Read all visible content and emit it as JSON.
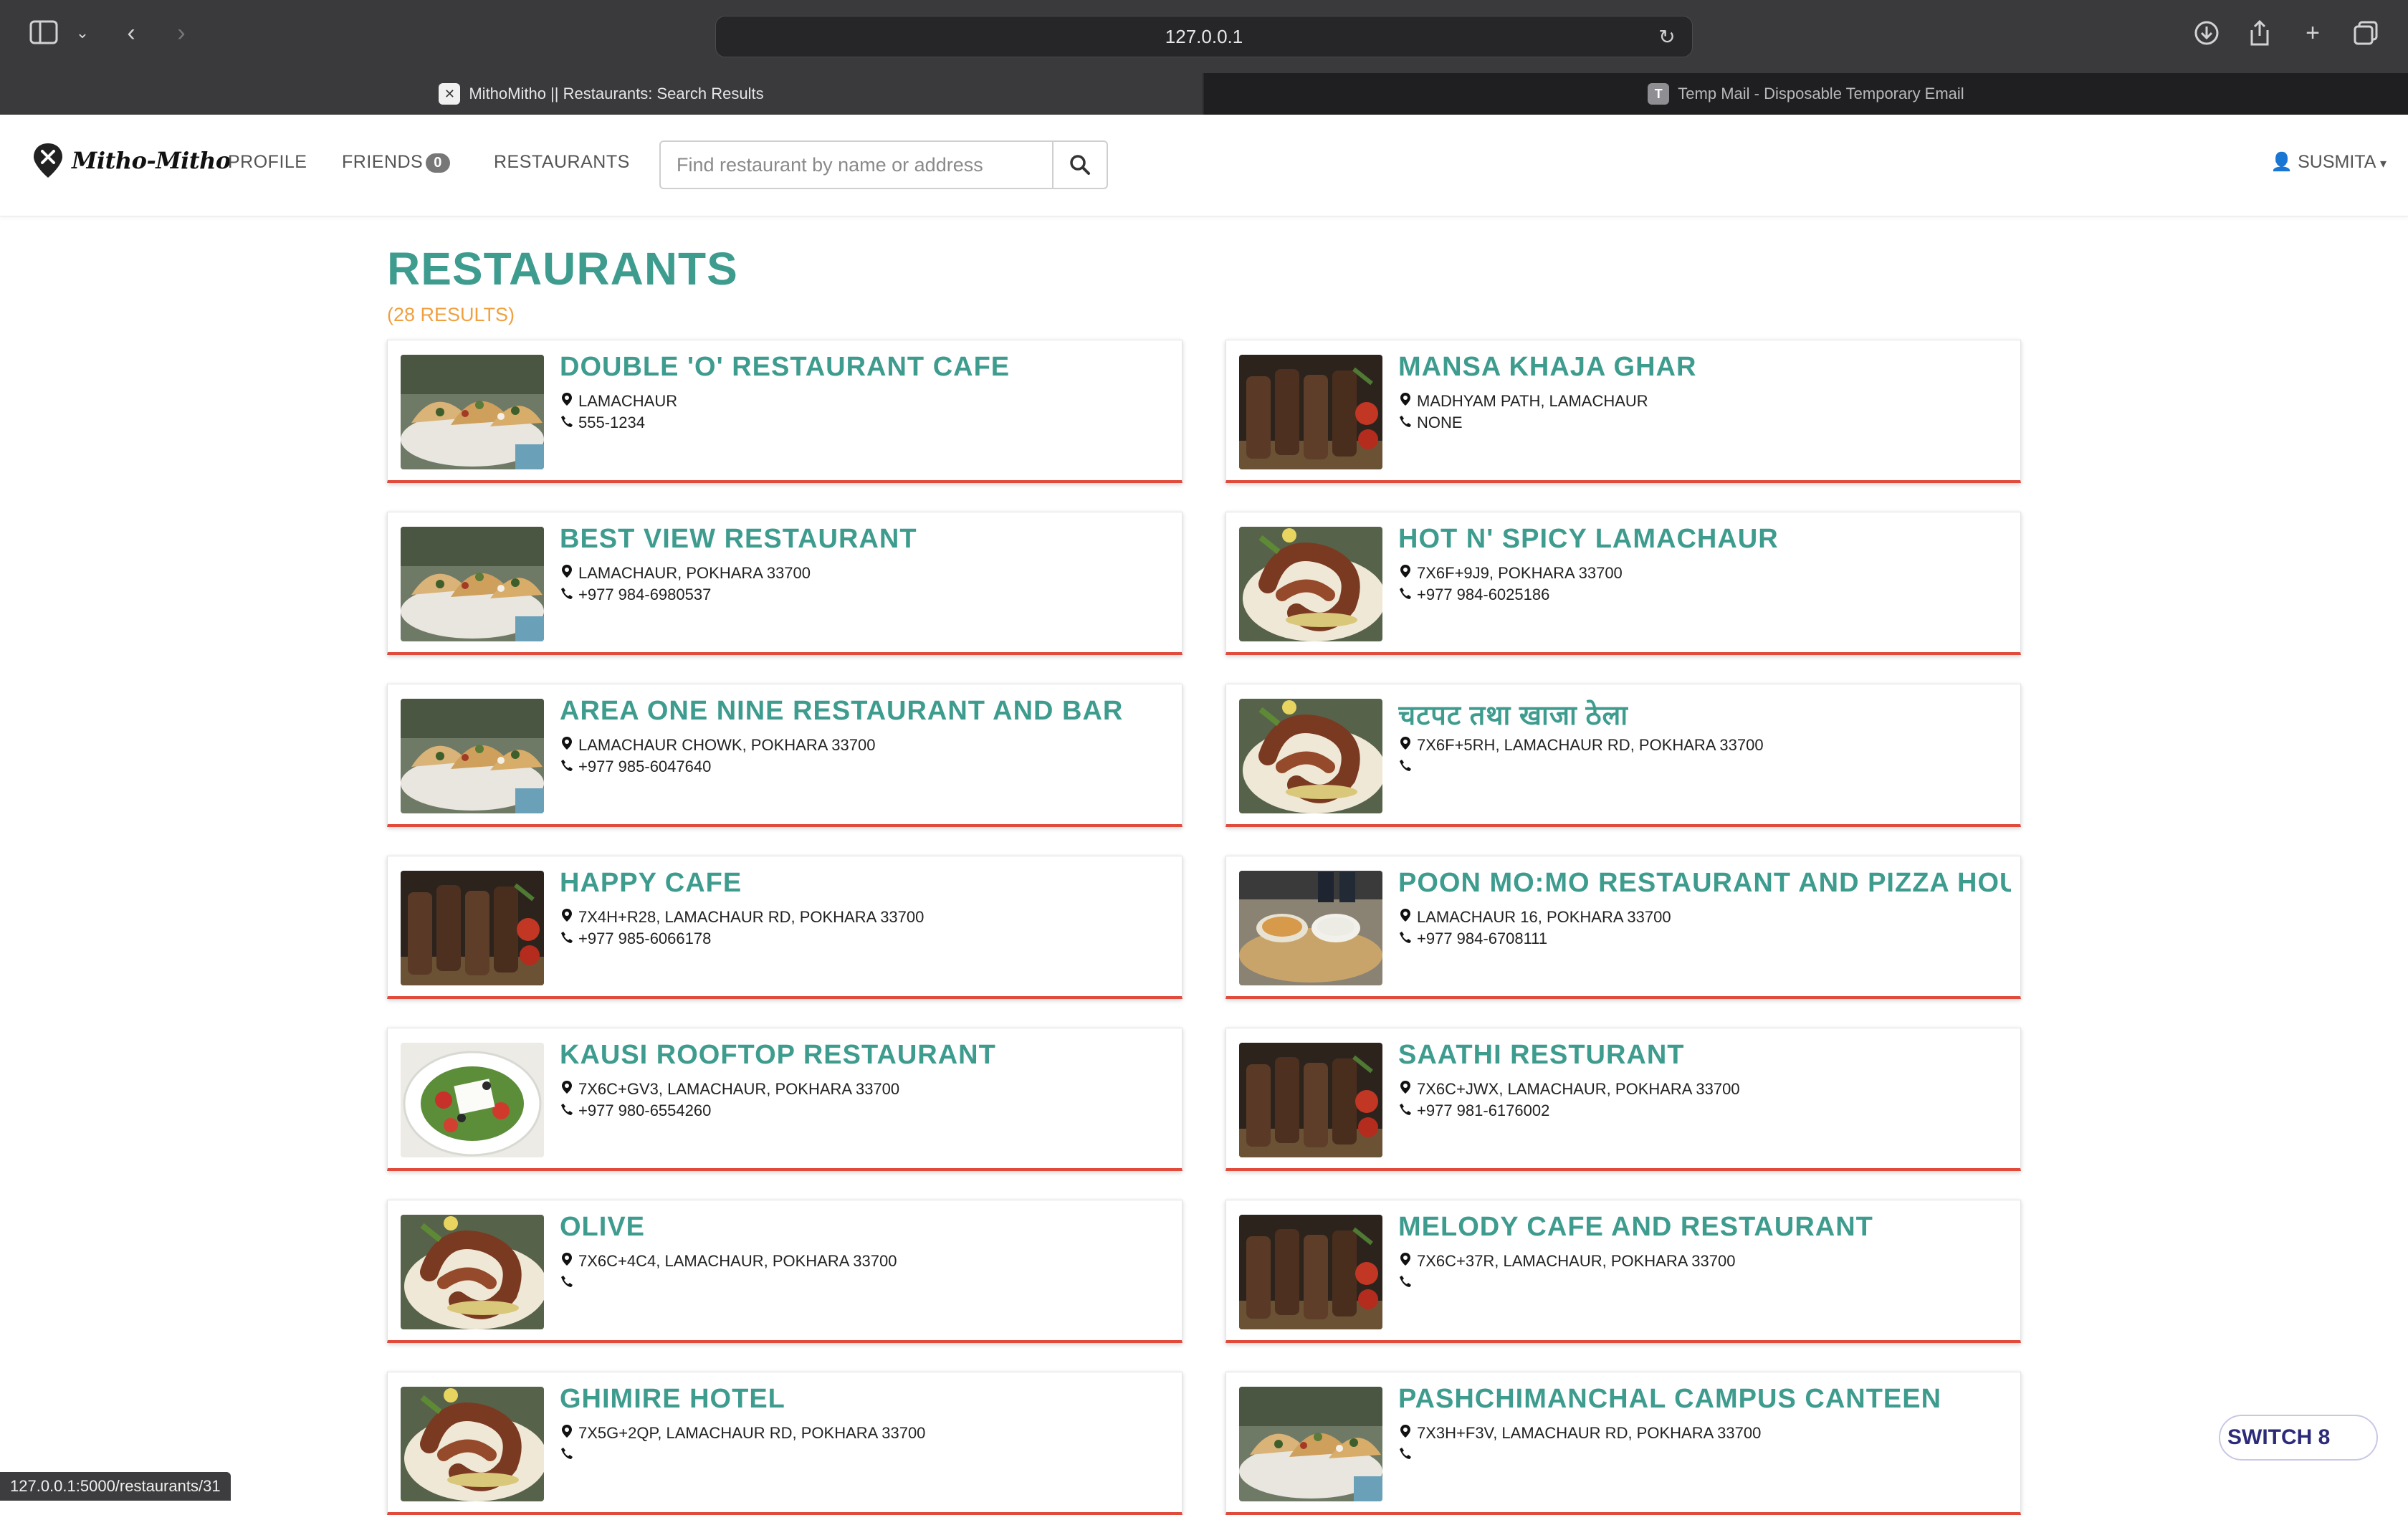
{
  "browser": {
    "url": "127.0.0.1",
    "tabs": [
      {
        "title": "MithoMitho || Restaurants: Search Results",
        "active": true
      },
      {
        "title": "Temp Mail - Disposable Temporary Email",
        "active": false
      }
    ],
    "status_url": "127.0.0.1:5000/restaurants/31"
  },
  "navbar": {
    "brand": "Mitho-Mitho",
    "links": {
      "profile": "PROFILE",
      "friends": "FRIENDS",
      "friends_count": "0",
      "restaurants": "RESTAURANTS"
    },
    "search_placeholder": "Find restaurant by name or address",
    "user": "SUSMITA"
  },
  "page": {
    "title": "RESTAURANTS",
    "results": "(28 RESULTS)"
  },
  "restaurants": [
    {
      "name": "DOUBLE 'O' RESTAURANT CAFE",
      "address": "LAMACHAUR",
      "phone": "555-1234",
      "image": "tacos"
    },
    {
      "name": "MANSA KHAJA GHAR",
      "address": "MADHYAM PATH, LAMACHAUR",
      "phone": "NONE",
      "image": "kebab"
    },
    {
      "name": "BEST VIEW RESTAURANT",
      "address": "LAMACHAUR, POKHARA 33700",
      "phone": "+977 984-6980537",
      "image": "tacos"
    },
    {
      "name": "HOT N' SPICY LAMACHAUR",
      "address": "7X6F+9J9, POKHARA 33700",
      "phone": "+977 984-6025186",
      "image": "octopus"
    },
    {
      "name": "AREA ONE NINE RESTAURANT AND BAR",
      "address": "LAMACHAUR CHOWK, POKHARA 33700",
      "phone": "+977 985-6047640",
      "image": "tacos"
    },
    {
      "name": "चटपट तथा खाजा ठेला",
      "address": "7X6F+5RH, LAMACHAUR RD, POKHARA 33700",
      "phone": "",
      "image": "octopus"
    },
    {
      "name": "HAPPY CAFE",
      "address": "7X4H+R28, LAMACHAUR RD, POKHARA 33700",
      "phone": "+977 985-6066178",
      "image": "kebab"
    },
    {
      "name": "POON MO:MO RESTAURANT AND PIZZA HOU",
      "address": "LAMACHAUR 16, POKHARA 33700",
      "phone": "+977 984-6708111",
      "image": "dips"
    },
    {
      "name": "KAUSI ROOFTOP RESTAURANT",
      "address": "7X6C+GV3, LAMACHAUR, POKHARA 33700",
      "phone": "+977 980-6554260",
      "image": "salad"
    },
    {
      "name": "SAATHI RESTURANT",
      "address": "7X6C+JWX, LAMACHAUR, POKHARA 33700",
      "phone": "+977 981-6176002",
      "image": "kebab"
    },
    {
      "name": "OLIVE",
      "address": "7X6C+4C4, LAMACHAUR, POKHARA 33700",
      "phone": "",
      "image": "octopus"
    },
    {
      "name": "MELODY CAFE AND RESTAURANT",
      "address": "7X6C+37R, LAMACHAUR, POKHARA 33700",
      "phone": "",
      "image": "kebab"
    },
    {
      "name": "GHIMIRE HOTEL",
      "address": "7X5G+2QP, LAMACHAUR RD, POKHARA 33700",
      "phone": "",
      "image": "octopus"
    },
    {
      "name": "PASHCHIMANCHAL CAMPUS CANTEEN",
      "address": "7X3H+F3V, LAMACHAUR RD, POKHARA 33700",
      "phone": "",
      "image": "tacos"
    }
  ],
  "floating": {
    "switch_label": "SWITCH 8"
  },
  "colors": {
    "accent": "#3e9c8f",
    "results": "#f0a040",
    "card_border": "#e04b3c"
  }
}
